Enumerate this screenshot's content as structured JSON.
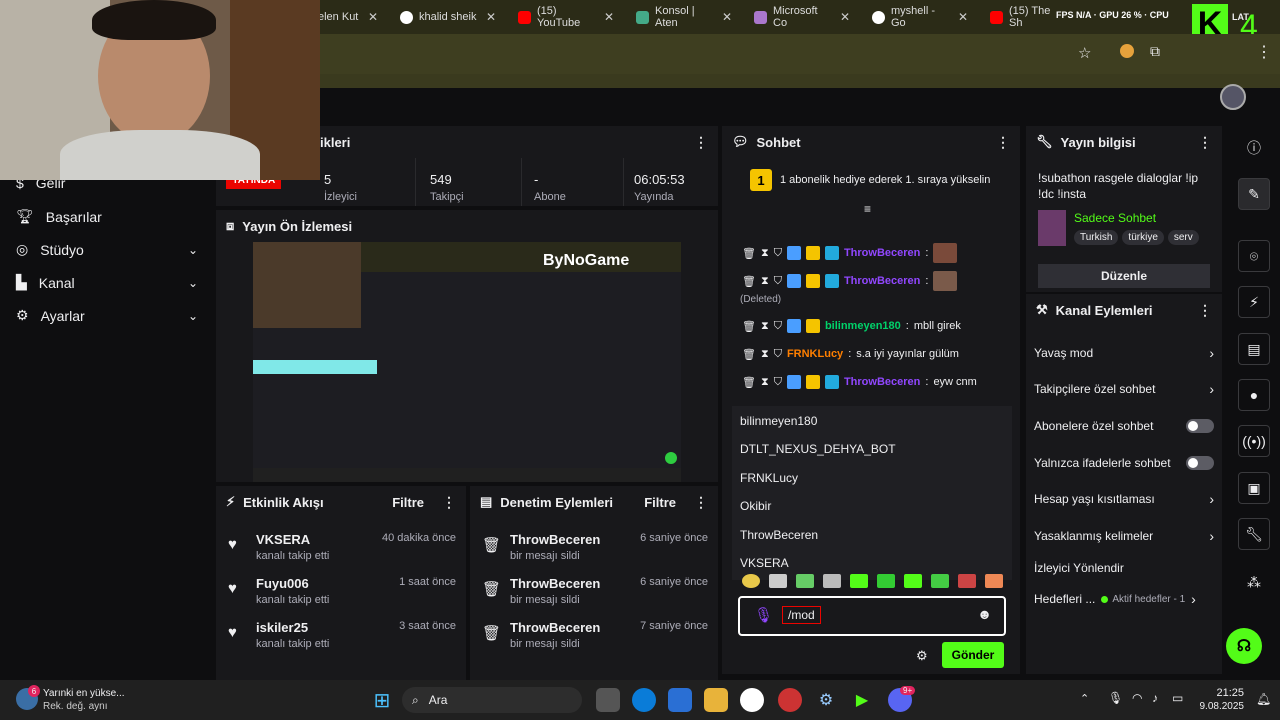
{
  "browser": {
    "tabs": [
      {
        "label": "elen Kut",
        "color": "#e44"
      },
      {
        "label": "khalid sheik",
        "color": "#4285f4"
      },
      {
        "label": "(15) YouTube",
        "color": "#f00"
      },
      {
        "label": "Konsol | Aten",
        "color": "#4a8"
      },
      {
        "label": "Microsoft Co",
        "color": "#a7c"
      },
      {
        "label": "myshell - Go",
        "color": "#4285f4"
      },
      {
        "label": "(15) The Sh",
        "color": "#f00"
      }
    ],
    "overlay": {
      "fps_label": "FPS",
      "fps_value": "N/A",
      "gpu_label": "GPU",
      "gpu_value": "26 %",
      "cpu_label": "CPU",
      "lat_label": "LAT",
      "logo_letter": "K",
      "logo_num": "4"
    }
  },
  "sidebar": {
    "items": [
      {
        "label": "Gelir",
        "icon": "money-icon"
      },
      {
        "label": "Başarılar",
        "icon": "trophy-icon"
      },
      {
        "label": "Stüdyo",
        "icon": "studio-icon"
      },
      {
        "label": "Kanal",
        "icon": "channel-icon"
      },
      {
        "label": "Ayarlar",
        "icon": "gear-icon"
      }
    ]
  },
  "stats_panel": {
    "title": "ikleri",
    "live": "YAYINDA",
    "stats": [
      {
        "value": "5",
        "label": "İzleyici"
      },
      {
        "value": "549",
        "label": "Takipçi"
      },
      {
        "value": "-",
        "label": "Abone"
      },
      {
        "value": "06:05:53",
        "label": "Yayında"
      }
    ]
  },
  "preview": {
    "title": "Yayın Ön İzlemesi",
    "brand": "ByNoGame"
  },
  "activity": {
    "title": "Etkinlik Akışı",
    "filter": "Filtre",
    "items": [
      {
        "name": "VKSERA",
        "sub": "kanalı takip etti",
        "time": "40 dakika önce"
      },
      {
        "name": "Fuyu006",
        "sub": "kanalı takip etti",
        "time": "1 saat önce"
      },
      {
        "name": "iskiler25",
        "sub": "kanalı takip etti",
        "time": "3 saat önce"
      }
    ]
  },
  "moderation": {
    "title": "Denetim Eylemleri",
    "filter": "Filtre",
    "items": [
      {
        "name": "ThrowBeceren",
        "sub": "bir mesajı sildi",
        "time": "6 saniye önce"
      },
      {
        "name": "ThrowBeceren",
        "sub": "bir mesajı sildi",
        "time": "6 saniye önce"
      },
      {
        "name": "ThrowBeceren",
        "sub": "bir mesajı sildi",
        "time": "7 saniye önce"
      }
    ]
  },
  "chat": {
    "title": "Sohbet",
    "hype_num": "1",
    "hype_text": "1 abonelik hediye ederek 1. sıraya yükselin",
    "messages": [
      {
        "user": "ThrowBeceren",
        "text": "",
        "color": "#9147ff"
      },
      {
        "user": "ThrowBeceren",
        "text": "",
        "color": "#9147ff",
        "deleted": "(Deleted)"
      },
      {
        "user": "bilinmeyen180",
        "text": "mbll girek",
        "color": "#00d26a"
      },
      {
        "user": "FRNKLucy",
        "text": "s.a iyi yayınlar gülüm",
        "color": "#ff7f00"
      },
      {
        "user": "ThrowBeceren",
        "text": "eyw cnm",
        "color": "#9147ff"
      }
    ],
    "suggestions": [
      "bilinmeyen180",
      "DTLT_NEXUS_DEHYA_BOT",
      "FRNKLucy",
      "Okibir",
      "ThrowBeceren",
      "VKSERA"
    ],
    "input_value": "/mod",
    "send": "Gönder"
  },
  "stream_info": {
    "title": "Yayın bilgisi",
    "stream_title": "!subathon rasgele dialoglar !ip !dc !insta",
    "category": "Sadece Sohbet",
    "tags": [
      "Turkish",
      "türkiye",
      "serv"
    ],
    "edit": "Düzenle"
  },
  "channel_actions": {
    "title": "Kanal Eylemleri",
    "items": [
      {
        "label": "Yavaş mod",
        "type": "arrow"
      },
      {
        "label": "Takipçilere özel sohbet",
        "type": "arrow"
      },
      {
        "label": "Abonelere özel sohbet",
        "type": "toggle"
      },
      {
        "label": "Yalnızca ifadelerle sohbet",
        "type": "toggle"
      },
      {
        "label": "Hesap yaşı kısıtlaması",
        "type": "arrow"
      },
      {
        "label": "Yasaklanmış kelimeler",
        "type": "arrow"
      },
      {
        "label": "İzleyici Yönlendir",
        "type": "none"
      },
      {
        "label": "Hedefleri ...",
        "type": "arrow",
        "extra": "Aktif hedefler - 1"
      }
    ]
  },
  "taskbar": {
    "notif_count": "6",
    "weather_title": "Yarınki en yükse...",
    "weather_sub": "Rek. değ. aynı",
    "search": "Ara",
    "discord_badge": "9+",
    "time": "21:25",
    "date": "9.08.2025"
  }
}
